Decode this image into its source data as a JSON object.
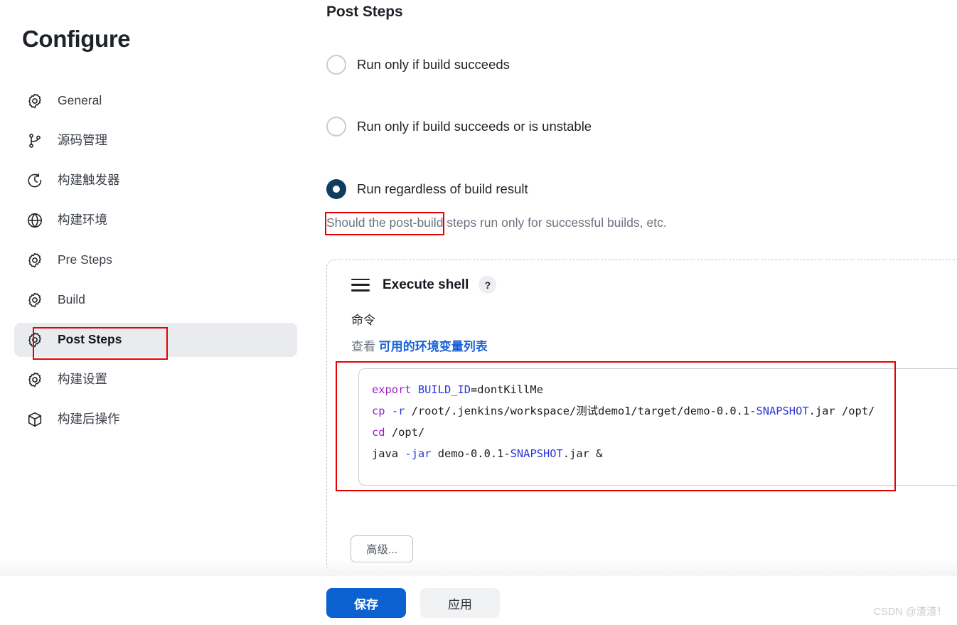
{
  "page": {
    "title": "Configure"
  },
  "sidebar": {
    "items": [
      {
        "label": "General",
        "icon": "gear-icon",
        "active": false
      },
      {
        "label": "源码管理",
        "icon": "branch-icon",
        "active": false
      },
      {
        "label": "构建触发器",
        "icon": "clock-icon",
        "active": false
      },
      {
        "label": "构建环境",
        "icon": "globe-icon",
        "active": false
      },
      {
        "label": "Pre Steps",
        "icon": "gear-icon",
        "active": false
      },
      {
        "label": "Build",
        "icon": "gear-icon",
        "active": false
      },
      {
        "label": "Post Steps",
        "icon": "gear-icon",
        "active": true
      },
      {
        "label": "构建设置",
        "icon": "gear-icon",
        "active": false
      },
      {
        "label": "构建后操作",
        "icon": "package-icon",
        "active": false
      }
    ]
  },
  "main": {
    "section_title": "Post Steps",
    "radios": [
      {
        "label": "Run only if build succeeds",
        "checked": false
      },
      {
        "label": "Run only if build succeeds or is unstable",
        "checked": false
      },
      {
        "label": "Run regardless of build result",
        "checked": true
      }
    ],
    "help_text": "Should the post-build steps run only for successful builds, etc.",
    "builder": {
      "name": "Execute shell",
      "help_badge": "?",
      "field_label": "命令",
      "env_prefix": "查看",
      "env_link": "可用的环境变量列表",
      "code_lines": [
        {
          "tokens": [
            {
              "text": "export",
              "type": "kw"
            },
            {
              "text": " ",
              "type": "txt"
            },
            {
              "text": "BUILD_ID",
              "type": "var"
            },
            {
              "text": "=dontKillMe",
              "type": "txt"
            }
          ]
        },
        {
          "tokens": [
            {
              "text": "cp",
              "type": "kw"
            },
            {
              "text": " ",
              "type": "txt"
            },
            {
              "text": "-r",
              "type": "flag"
            },
            {
              "text": " /root/.jenkins/workspace/测试demo1/target/demo-0.0.1-",
              "type": "txt"
            },
            {
              "text": "SNAPSHOT",
              "type": "var"
            },
            {
              "text": ".jar /opt/",
              "type": "txt"
            }
          ]
        },
        {
          "tokens": [
            {
              "text": "cd",
              "type": "kw"
            },
            {
              "text": " /opt/",
              "type": "txt"
            }
          ]
        },
        {
          "tokens": [
            {
              "text": "java",
              "type": "txt"
            },
            {
              "text": " ",
              "type": "txt"
            },
            {
              "text": "-jar",
              "type": "flag"
            },
            {
              "text": " demo-0.0.1-",
              "type": "txt"
            },
            {
              "text": "SNAPSHOT",
              "type": "var"
            },
            {
              "text": ".jar &",
              "type": "txt"
            }
          ]
        }
      ],
      "advanced_label": "高级..."
    }
  },
  "footer": {
    "save_label": "保存",
    "apply_label": "应用"
  },
  "watermark": "CSDN @渣渣！",
  "colors": {
    "accent_blue": "#0b61cf",
    "link_blue": "#1a63d6",
    "radio_checked": "#0f3d5e",
    "annotation_red": "#e60000",
    "active_nav_bg": "#e9ebef",
    "code_keyword": "#9b1fc9",
    "code_variable": "#2b36d9"
  }
}
